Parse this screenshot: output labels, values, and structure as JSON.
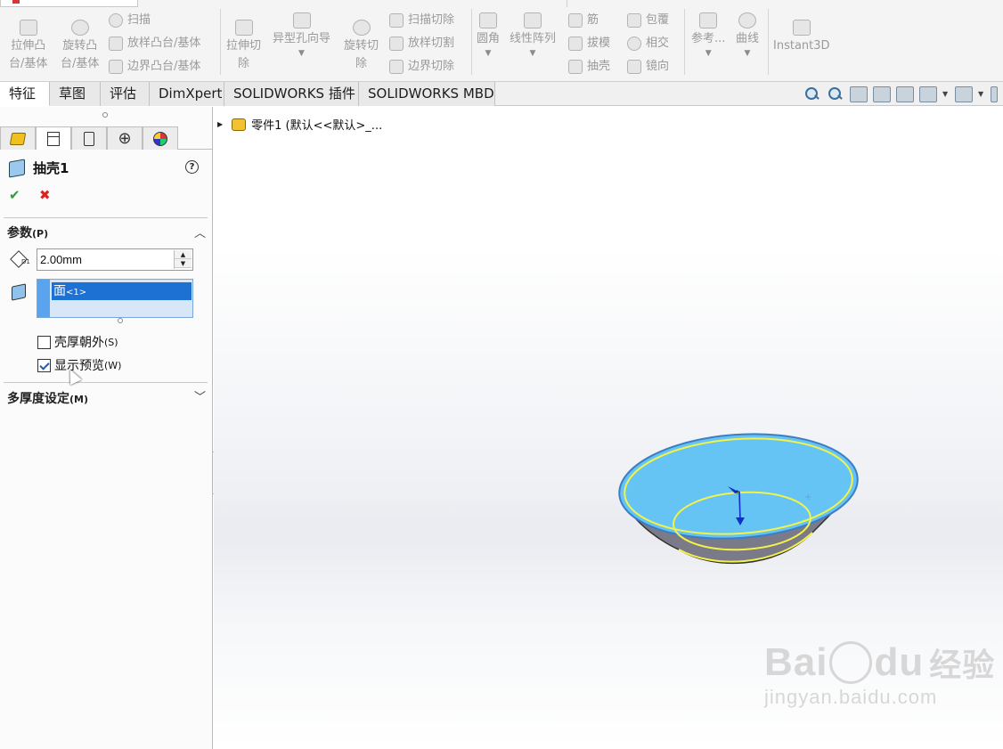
{
  "ribbon": {
    "extrude_boss": [
      "拉伸凸",
      "台/基体"
    ],
    "revolve_boss": [
      "旋转凸",
      "台/基体"
    ],
    "sweep": "扫描",
    "loft_boss": "放样凸台/基体",
    "boundary_boss": "边界凸台/基体",
    "extrude_cut": [
      "拉伸切",
      "除"
    ],
    "hole_wizard": "异型孔向导",
    "revolve_cut": [
      "旋转切",
      "除"
    ],
    "swept_cut": "扫描切除",
    "lofted_cut": "放样切割",
    "boundary_cut": "边界切除",
    "fillet": "圆角",
    "linear_pattern": "线性阵列",
    "rib": "筋",
    "draft": "拔模",
    "shell": "抽壳",
    "wrap": "包覆",
    "intersect": "相交",
    "mirror": "镜向",
    "reference": "参考...",
    "curves": "曲线",
    "instant3d": "Instant3D"
  },
  "tabs": [
    "特征",
    "草图",
    "评估",
    "DimXpert",
    "SOLIDWORKS 插件",
    "SOLIDWORKS MBD"
  ],
  "tree": {
    "root_label": "零件1  (默认<<默认>_..."
  },
  "panel": {
    "title": "抽壳1",
    "help": "?",
    "ok": "✔",
    "cancel": "✖",
    "params_header": "参数",
    "params_key": "(P)",
    "thickness_value": "2.00mm",
    "selected_face": "面",
    "selected_face_suffix": "<1>",
    "shell_outward": "壳厚朝外",
    "shell_outward_key": "(S)",
    "shell_outward_checked": false,
    "show_preview": "显示预览",
    "show_preview_key": "(W)",
    "show_preview_checked": true,
    "multi_thickness_header": "多厚度设定",
    "multi_thickness_key": "(M)"
  },
  "watermark": {
    "brand_a": "Bai",
    "brand_b": "du",
    "brand_c": "经验",
    "url": "jingyan.baidu.com"
  },
  "colors": {
    "model_fill": "#66c4f5",
    "edge_highlight": "#f2f24a",
    "arrow": "#1030c8",
    "selection": "#1d71d2"
  }
}
